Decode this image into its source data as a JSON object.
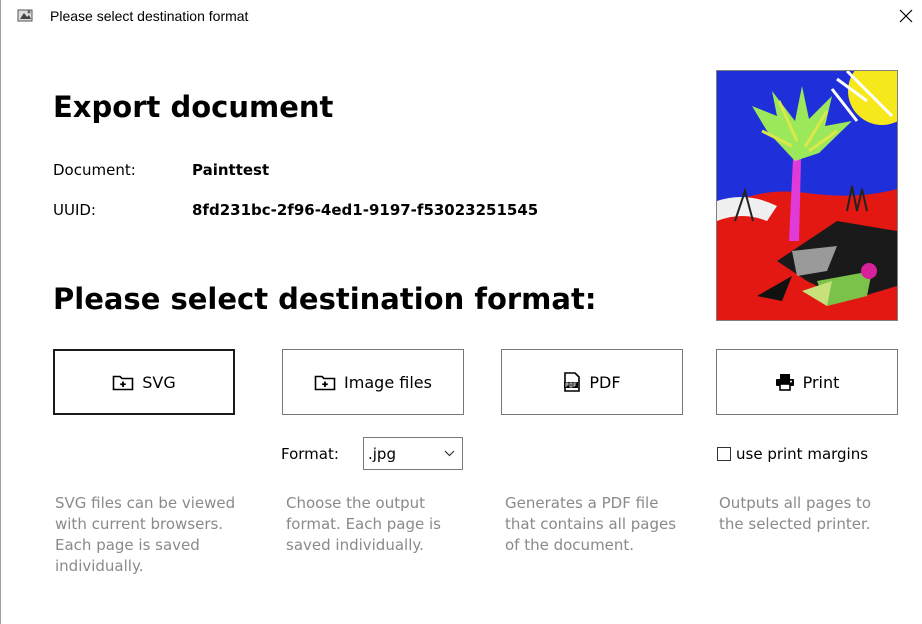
{
  "window": {
    "title": "Please select destination format",
    "close_glyph": "✕"
  },
  "header": {
    "heading": "Export document",
    "document_label": "Document:",
    "document_value": "Painttest",
    "uuid_label": "UUID:",
    "uuid_value": "8fd231bc-2f96-4ed1-9197-f53023251545"
  },
  "thumbnail": {
    "icon": "document-preview-image"
  },
  "formats": {
    "heading": "Please select destination format:",
    "buttons": [
      {
        "label": "SVG",
        "icon": "folder-add-icon"
      },
      {
        "label": "Image files",
        "icon": "folder-add-icon"
      },
      {
        "label": "PDF",
        "icon": "pdf-file-icon"
      },
      {
        "label": "Print",
        "icon": "printer-icon"
      }
    ],
    "image_format_label": "Format:",
    "image_format_value": ".jpg",
    "print_margins_label": "use print margins",
    "print_margins_checked": false,
    "descriptions": [
      "SVG files can be viewed with current browsers. Each page is saved individually.",
      "Choose the output format. Each page is saved individually.",
      "Generates a PDF file that contains all pages of the document.",
      "Outputs all pages to the selected printer."
    ]
  },
  "colors": {
    "description_text": "#8a8a8a",
    "border": "#767676"
  }
}
